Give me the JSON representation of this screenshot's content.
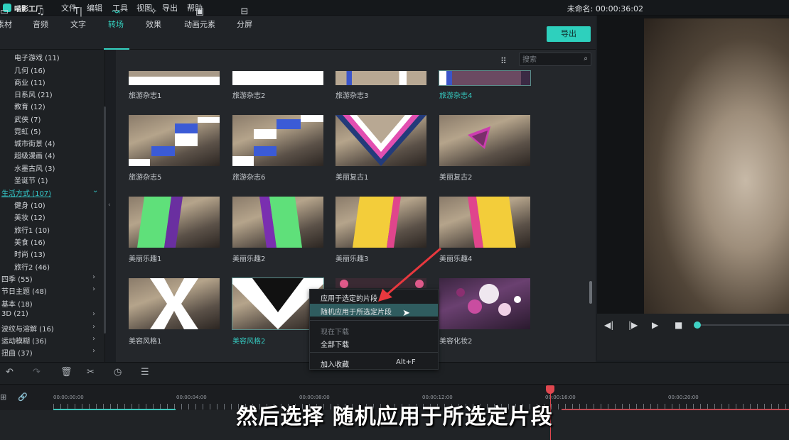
{
  "app": {
    "logo_text": "喵影工厂",
    "project_title": "未命名: 00:00:36:02"
  },
  "menu": [
    "文件",
    "编辑",
    "工具",
    "视图",
    "导出",
    "帮助"
  ],
  "toolbar": {
    "tabs": [
      {
        "label": "素材",
        "icon": "folder-icon"
      },
      {
        "label": "音频",
        "icon": "music-note-icon"
      },
      {
        "label": "文字",
        "icon": "text-icon"
      },
      {
        "label": "转场",
        "icon": "transition-icon"
      },
      {
        "label": "效果",
        "icon": "effects-icon"
      },
      {
        "label": "动画元素",
        "icon": "image-icon"
      },
      {
        "label": "分屏",
        "icon": "split-screen-icon"
      }
    ],
    "active": "转场",
    "export_label": "导出"
  },
  "sidebar": {
    "groups": [
      {
        "label": "电子游戏 (11)"
      },
      {
        "label": "几何 (16)"
      },
      {
        "label": "商业 (11)"
      },
      {
        "label": "日系风 (21)"
      },
      {
        "label": "教育 (12)"
      },
      {
        "label": "武侠 (7)"
      },
      {
        "label": "霓虹 (5)"
      },
      {
        "label": "城市街景 (4)"
      },
      {
        "label": "超级漫画 (4)"
      },
      {
        "label": "水墨古风 (3)"
      },
      {
        "label": "圣诞节 (1)"
      }
    ],
    "selected_group": "生活方式 (107)",
    "sub_items": [
      "健身 (10)",
      "美妆 (12)",
      "旅行1 (10)",
      "美食 (16)",
      "时尚 (13)",
      "旅行2 (46)"
    ],
    "more_groups": [
      "四季 (55)",
      "节日主题 (48)",
      "基本 (18)",
      "3D (21)",
      "波纹与溶解 (16)",
      "运动模糊 (36)",
      "扭曲 (37)"
    ]
  },
  "search": {
    "placeholder": "搜索"
  },
  "grid": {
    "row0": [
      "旅游杂志1",
      "旅游杂志2",
      "旅游杂志3",
      "旅游杂志4"
    ],
    "row1": [
      "旅游杂志5",
      "旅游杂志6",
      "美丽复古1",
      "美丽复古2"
    ],
    "row2": [
      "美丽乐趣1",
      "美丽乐趣2",
      "美丽乐趣3",
      "美丽乐趣4"
    ],
    "row3": [
      "美容风格1",
      "美容风格2",
      "美容化妆2"
    ]
  },
  "context_menu": {
    "items": [
      "应用于选定的片段",
      "随机应用于所选定片段",
      "现在下载",
      "全部下载",
      "加入收藏"
    ],
    "shortcut": "Alt+F"
  },
  "timeline": {
    "timecodes": [
      "00:00:00:00",
      "00:00:04:00",
      "00:00:08:00",
      "00:00:12:00",
      "00:00:16:00",
      "00:00:20:00"
    ]
  },
  "subtitle": "然后选择 随机应用于所选定片段",
  "colors": {
    "accent": "#2ed0bd",
    "playhead": "#e0474f",
    "arrow": "#e8383e"
  }
}
